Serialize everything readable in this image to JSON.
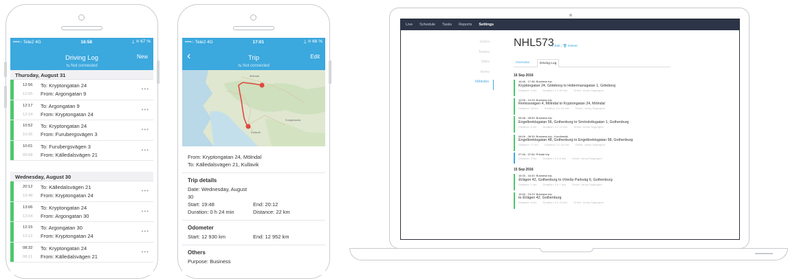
{
  "phone1": {
    "status": {
      "carrier": "••••○ Tele2  4G",
      "time": "16:58",
      "battery": "⟂ ✻ 67 %"
    },
    "nav": {
      "title": "Driving Log",
      "right": "New",
      "subtitle": "⇆ Not connected"
    },
    "days": [
      {
        "header": "Thursday, August 31",
        "trips": [
          {
            "t1": "12:56",
            "t2": "12:55",
            "to": "To: Kryptongatan 24",
            "from": "From: Argongatan 9"
          },
          {
            "t1": "12:17",
            "t2": "12:14",
            "to": "To: Argongatan 9",
            "from": "From: Kryptongatan 24"
          },
          {
            "t1": "10:52",
            "t2": "10:35",
            "to": "To: Kryptongatan 24",
            "from": "From: Furubergsvägen 3"
          },
          {
            "t1": "10:01",
            "t2": "09:58",
            "to": "To: Furubergsvägen 3",
            "from": "From: Källedalsvägen 21"
          }
        ]
      },
      {
        "header": "Wednesday, August 30",
        "trips": [
          {
            "t1": "20:12",
            "t2": "19:48",
            "to": "To: Källedalsvägen 21",
            "from": "From: Kryptongatan 24"
          },
          {
            "t1": "13:06",
            "t2": "13:04",
            "to": "To: Kryptongatan 24",
            "from": "From: Argongatan 30"
          },
          {
            "t1": "12:15",
            "t2": "12:12",
            "to": "To: Argongatan 30",
            "from": "From: Kryptongatan 24"
          },
          {
            "t1": "08:32",
            "t2": "08:11",
            "to": "To: Kryptongatan 24",
            "from": "From: Källedalsvägen 21"
          }
        ]
      }
    ]
  },
  "phone2": {
    "status": {
      "carrier": "••••○ Tele2  4G",
      "time": "17:01",
      "battery": "⟂ ✻ 66 %"
    },
    "nav": {
      "title": "Trip",
      "right": "Edit",
      "back": "‹",
      "subtitle": "⇆ Not connected"
    },
    "map_labels": {
      "city1": "Mölndal",
      "city2": "Kungsbacka",
      "city3": "Kullavik"
    },
    "from": "From: Kryptongatan 24, Mölndal",
    "to": "To: Källedalsvägen 21, Kullavik",
    "details": {
      "heading": "Trip details",
      "date": "Date: Wednesday, August 30",
      "start": "Start: 19:48",
      "end": "End: 20:12",
      "duration": "Duration: 0 h 24 min",
      "distance": "Distance: 22 km"
    },
    "odometer": {
      "heading": "Odometer",
      "start": "Start: 12 930 km",
      "end": "End: 12 952 km"
    },
    "others": {
      "heading": "Others",
      "purpose": "Purpose: Business"
    }
  },
  "laptop": {
    "nav": [
      "Live",
      "Schedule",
      "Tasks",
      "Reports",
      "Settings"
    ],
    "sidebar": [
      "Users",
      "Teams",
      "Sites",
      "Items",
      "Vehicles"
    ],
    "vehicle": "NHL573",
    "edit": "✎ Edit",
    "delete": "🗑 Delete",
    "tabs": [
      "Overview",
      "Driving Log"
    ],
    "sections": [
      {
        "date": "16 Sep 2016",
        "trips": [
          {
            "color": "#4ec76b",
            "time": "16:46 - 17:36: Business trip",
            "route": "Kryptongatan 24, Göteborg to Holtermansgatan 1, Göteborg",
            "distance": "Distance: 4 km",
            "duration": "Duration: 0 h 50 min",
            "driver": "Driver: Jenny Segergren"
          },
          {
            "color": "#4ec76b",
            "time": "10:05 - 10:29: Business trip",
            "route": "Remissvägen 4, Mölndal to Kryptongatan 24, Mölndal",
            "distance": "Distance: 16 km",
            "duration": "Duration: 0 h 24 min",
            "driver": "Driver: Jenny Segergren"
          },
          {
            "color": "#4ec76b",
            "time": "08:48 - 08:59: Business trip",
            "route": "Engelbrektsgatan 56, Gothenburg to Smörslottsgatan 1, Gothenburg",
            "distance": "Distance: 6 km",
            "duration": "Duration: 0 h 15 min",
            "driver": "Driver: Jenny Segergren"
          },
          {
            "color": "#4ec76b",
            "time": "08:06 - 08:39: Business trip - Kundbesök",
            "route": "Engelbrektsgatan 48, Gothenburg to Engelbrektsgatan 58, Gothenburg",
            "distance": "Distance: 17 km",
            "duration": "Duration: 0 h 33 min",
            "driver": "Driver: Jenny Segergren"
          },
          {
            "color": "#3ba8de",
            "time": "07:46 - 07:54: Private trip",
            "route": "",
            "distance": "Distance: 2 km",
            "duration": "Duration: 0 h 8 min",
            "driver": "Driver: Jenny Segergren"
          }
        ]
      },
      {
        "date": "15 Sep 2016",
        "trips": [
          {
            "color": "#4ec76b",
            "time": "16:33 - 16:40: Business trip",
            "route": "åVägen 42, Gothenburg to öVerås Parkväg 6, Gothenburg",
            "distance": "Distance: 1 km",
            "duration": "Duration: 0 h 7 min",
            "driver": "Driver: Jenny Segergren"
          },
          {
            "color": "#4ec76b",
            "time": "15:00 - 15:23: Business trip",
            "route": "to åVägen 42, Gothenburg",
            "distance": "Distance: 8 km",
            "duration": "Duration: 0 h 23 min",
            "driver": "Driver: Jenny Segergren"
          }
        ]
      }
    ]
  }
}
